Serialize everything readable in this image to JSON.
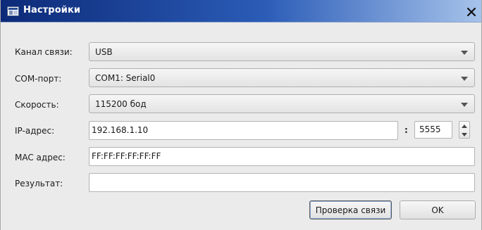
{
  "window": {
    "title": "Настройки",
    "icons": {
      "app": "app-window-icon",
      "close": "close-icon"
    }
  },
  "form": {
    "channel": {
      "label": "Канал связи:",
      "value": "USB"
    },
    "com_port": {
      "label": "COM-порт:",
      "value": "COM1: Serial0"
    },
    "speed": {
      "label": "Скорость:",
      "value": "115200 бод"
    },
    "ip": {
      "label": "IP-адрес:",
      "value": "192.168.1.10",
      "separator": ":",
      "port": "5555"
    },
    "mac": {
      "label": "MAC адрес:",
      "value": "FF:FF:FF:FF:FF:FF"
    },
    "result": {
      "label": "Результат:",
      "value": ""
    }
  },
  "buttons": {
    "check": "Проверка связи",
    "ok": "OK"
  },
  "colors": {
    "title_start": "#0c2a78",
    "title_end": "#a6c3ea",
    "dialog_bg": "#ebebeb"
  }
}
